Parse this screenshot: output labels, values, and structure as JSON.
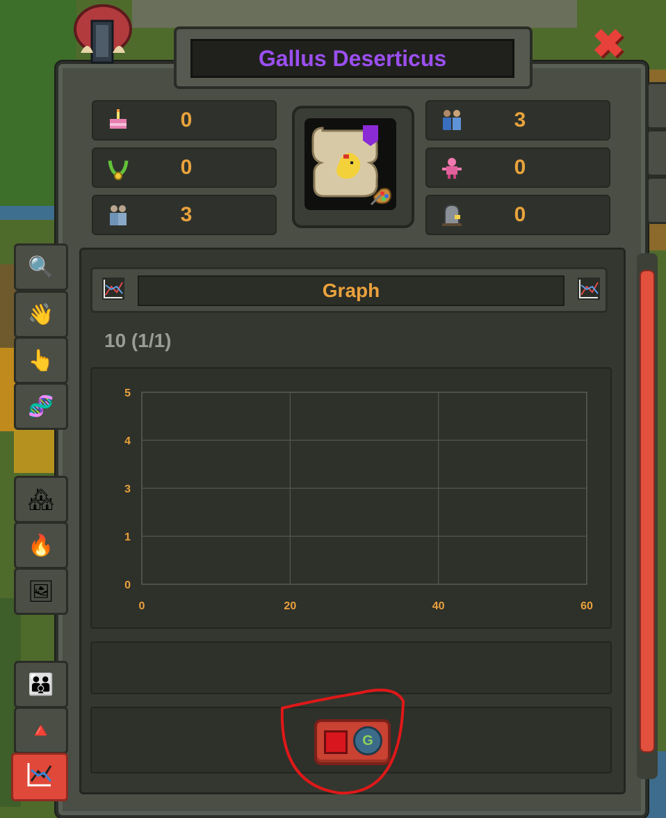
{
  "window": {
    "title": "Gallus Deserticus",
    "close_label": "✖"
  },
  "stats_left": [
    {
      "icon": "birthday-cake-icon",
      "value": "0"
    },
    {
      "icon": "laurel-medal-icon",
      "value": "0"
    },
    {
      "icon": "population-icon",
      "value": "3"
    }
  ],
  "stats_right": [
    {
      "icon": "couple-icon",
      "value": "3"
    },
    {
      "icon": "pink-creature-icon",
      "value": "0"
    },
    {
      "icon": "gravestone-icon",
      "value": "0"
    }
  ],
  "graph": {
    "header": "Graph",
    "count_label": "10 (1/1)"
  },
  "chart_data": {
    "type": "line",
    "title": "",
    "xlabel": "",
    "ylabel": "",
    "x_ticks": [
      "0",
      "20",
      "40",
      "60"
    ],
    "y_ticks": [
      "0",
      "1",
      "3",
      "4",
      "5"
    ],
    "xlim": [
      0,
      60
    ],
    "series": [],
    "grid": true
  },
  "colors": {
    "title": "#9b4ff0",
    "value": "#e9a33c",
    "accent": "#e2503e"
  }
}
